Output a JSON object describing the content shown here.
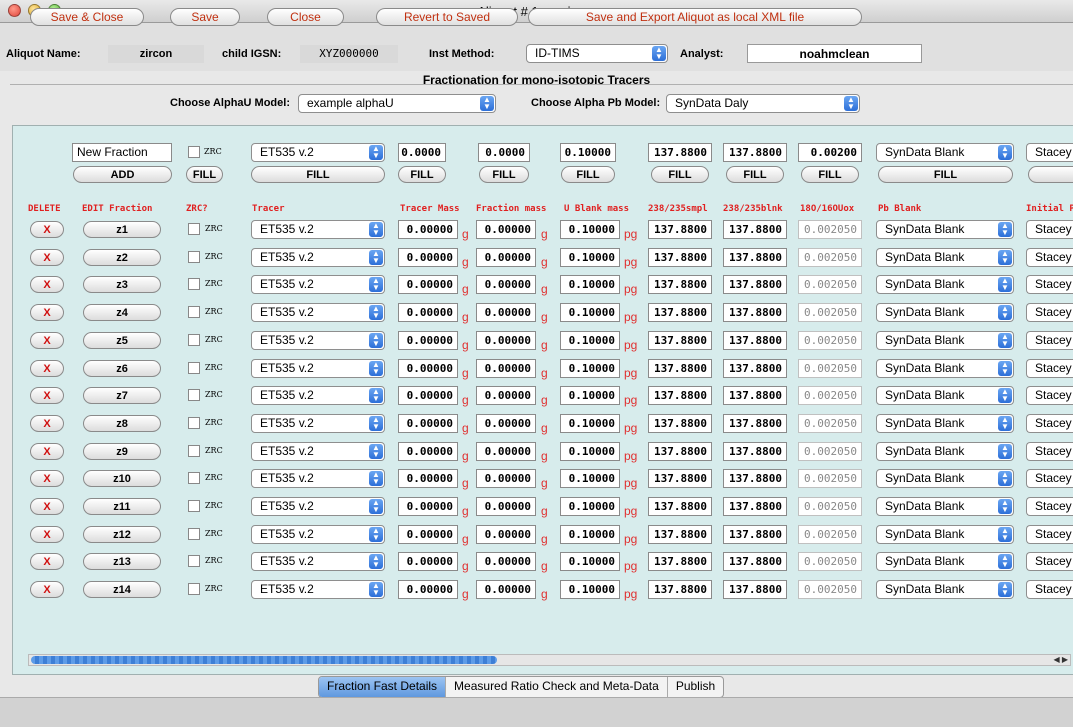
{
  "window": {
    "title": "Aliquot # 1 <> zircon"
  },
  "header": {
    "aliquot_name_label": "Aliquot Name:",
    "aliquot_name": "zircon",
    "child_igsn_label": "child IGSN:",
    "child_igsn": "XYZ000000",
    "inst_method_label": "Inst Method:",
    "inst_method": "ID-TIMS",
    "analyst_label": "Analyst:",
    "analyst": "noahmclean"
  },
  "fractionation": {
    "title": "Fractionation for mono-isotopic Tracers",
    "alphaU_label": "Choose AlphaU Model:",
    "alphaU_value": "example alphaU",
    "alphaPb_label": "Choose Alpha Pb Model:",
    "alphaPb_value": "SynData Daly"
  },
  "template_row": {
    "name": "New Fraction",
    "add_label": "ADD",
    "zrc_label": "ZRC",
    "tracer": "ET535 v.2",
    "tracer_mass": "0.0000",
    "fraction_mass": "0.0000",
    "u_blank_mass": "0.10000",
    "r238_235_smpl": "137.8800",
    "r238_235_blnk": "137.8800",
    "r18o_16o": "0.00200",
    "pb_blank": "SynData Blank",
    "initial": "Stacey",
    "fill_label": "FILL"
  },
  "columns": {
    "delete": "DELETE",
    "edit": "EDIT Fraction",
    "zrc": "ZRC?",
    "tracer": "Tracer",
    "tracer_mass": "Tracer Mass",
    "fraction_mass": "Fraction mass",
    "u_blank_mass": "U Blank mass",
    "smpl": "238/235smpl",
    "blnk": "238/235blnk",
    "ox": "18O/16OUox",
    "pb_blank": "Pb Blank",
    "initial": "Initial P"
  },
  "row_defaults": {
    "delete_label": "X",
    "zrc_label": "ZRC",
    "tracer": "ET535 v.2",
    "tracer_mass": "0.00000",
    "g_unit": "g",
    "fraction_mass": "0.00000",
    "u_blank_mass": "0.10000",
    "pg_unit": "pg",
    "smpl": "137.8800",
    "blnk": "137.8800",
    "ox": "0.002050",
    "pb_blank": "SynData Blank",
    "initial": "Stacey"
  },
  "fractions": [
    "z1",
    "z2",
    "z3",
    "z4",
    "z5",
    "z6",
    "z7",
    "z8",
    "z9",
    "z10",
    "z11",
    "z12",
    "z13",
    "z14"
  ],
  "tabs": [
    "Fraction Fast Details",
    "Measured Ratio Check and Meta-Data",
    "Publish"
  ],
  "footer": {
    "save_close": "Save & Close",
    "save": "Save",
    "close": "Close",
    "revert": "Revert to Saved",
    "export": "Save and Export Aliquot as local XML file"
  },
  "colors": {
    "accent_red": "#e02020",
    "panel_teal": "#d7ecec",
    "select_blue": "#2d6fd8"
  }
}
